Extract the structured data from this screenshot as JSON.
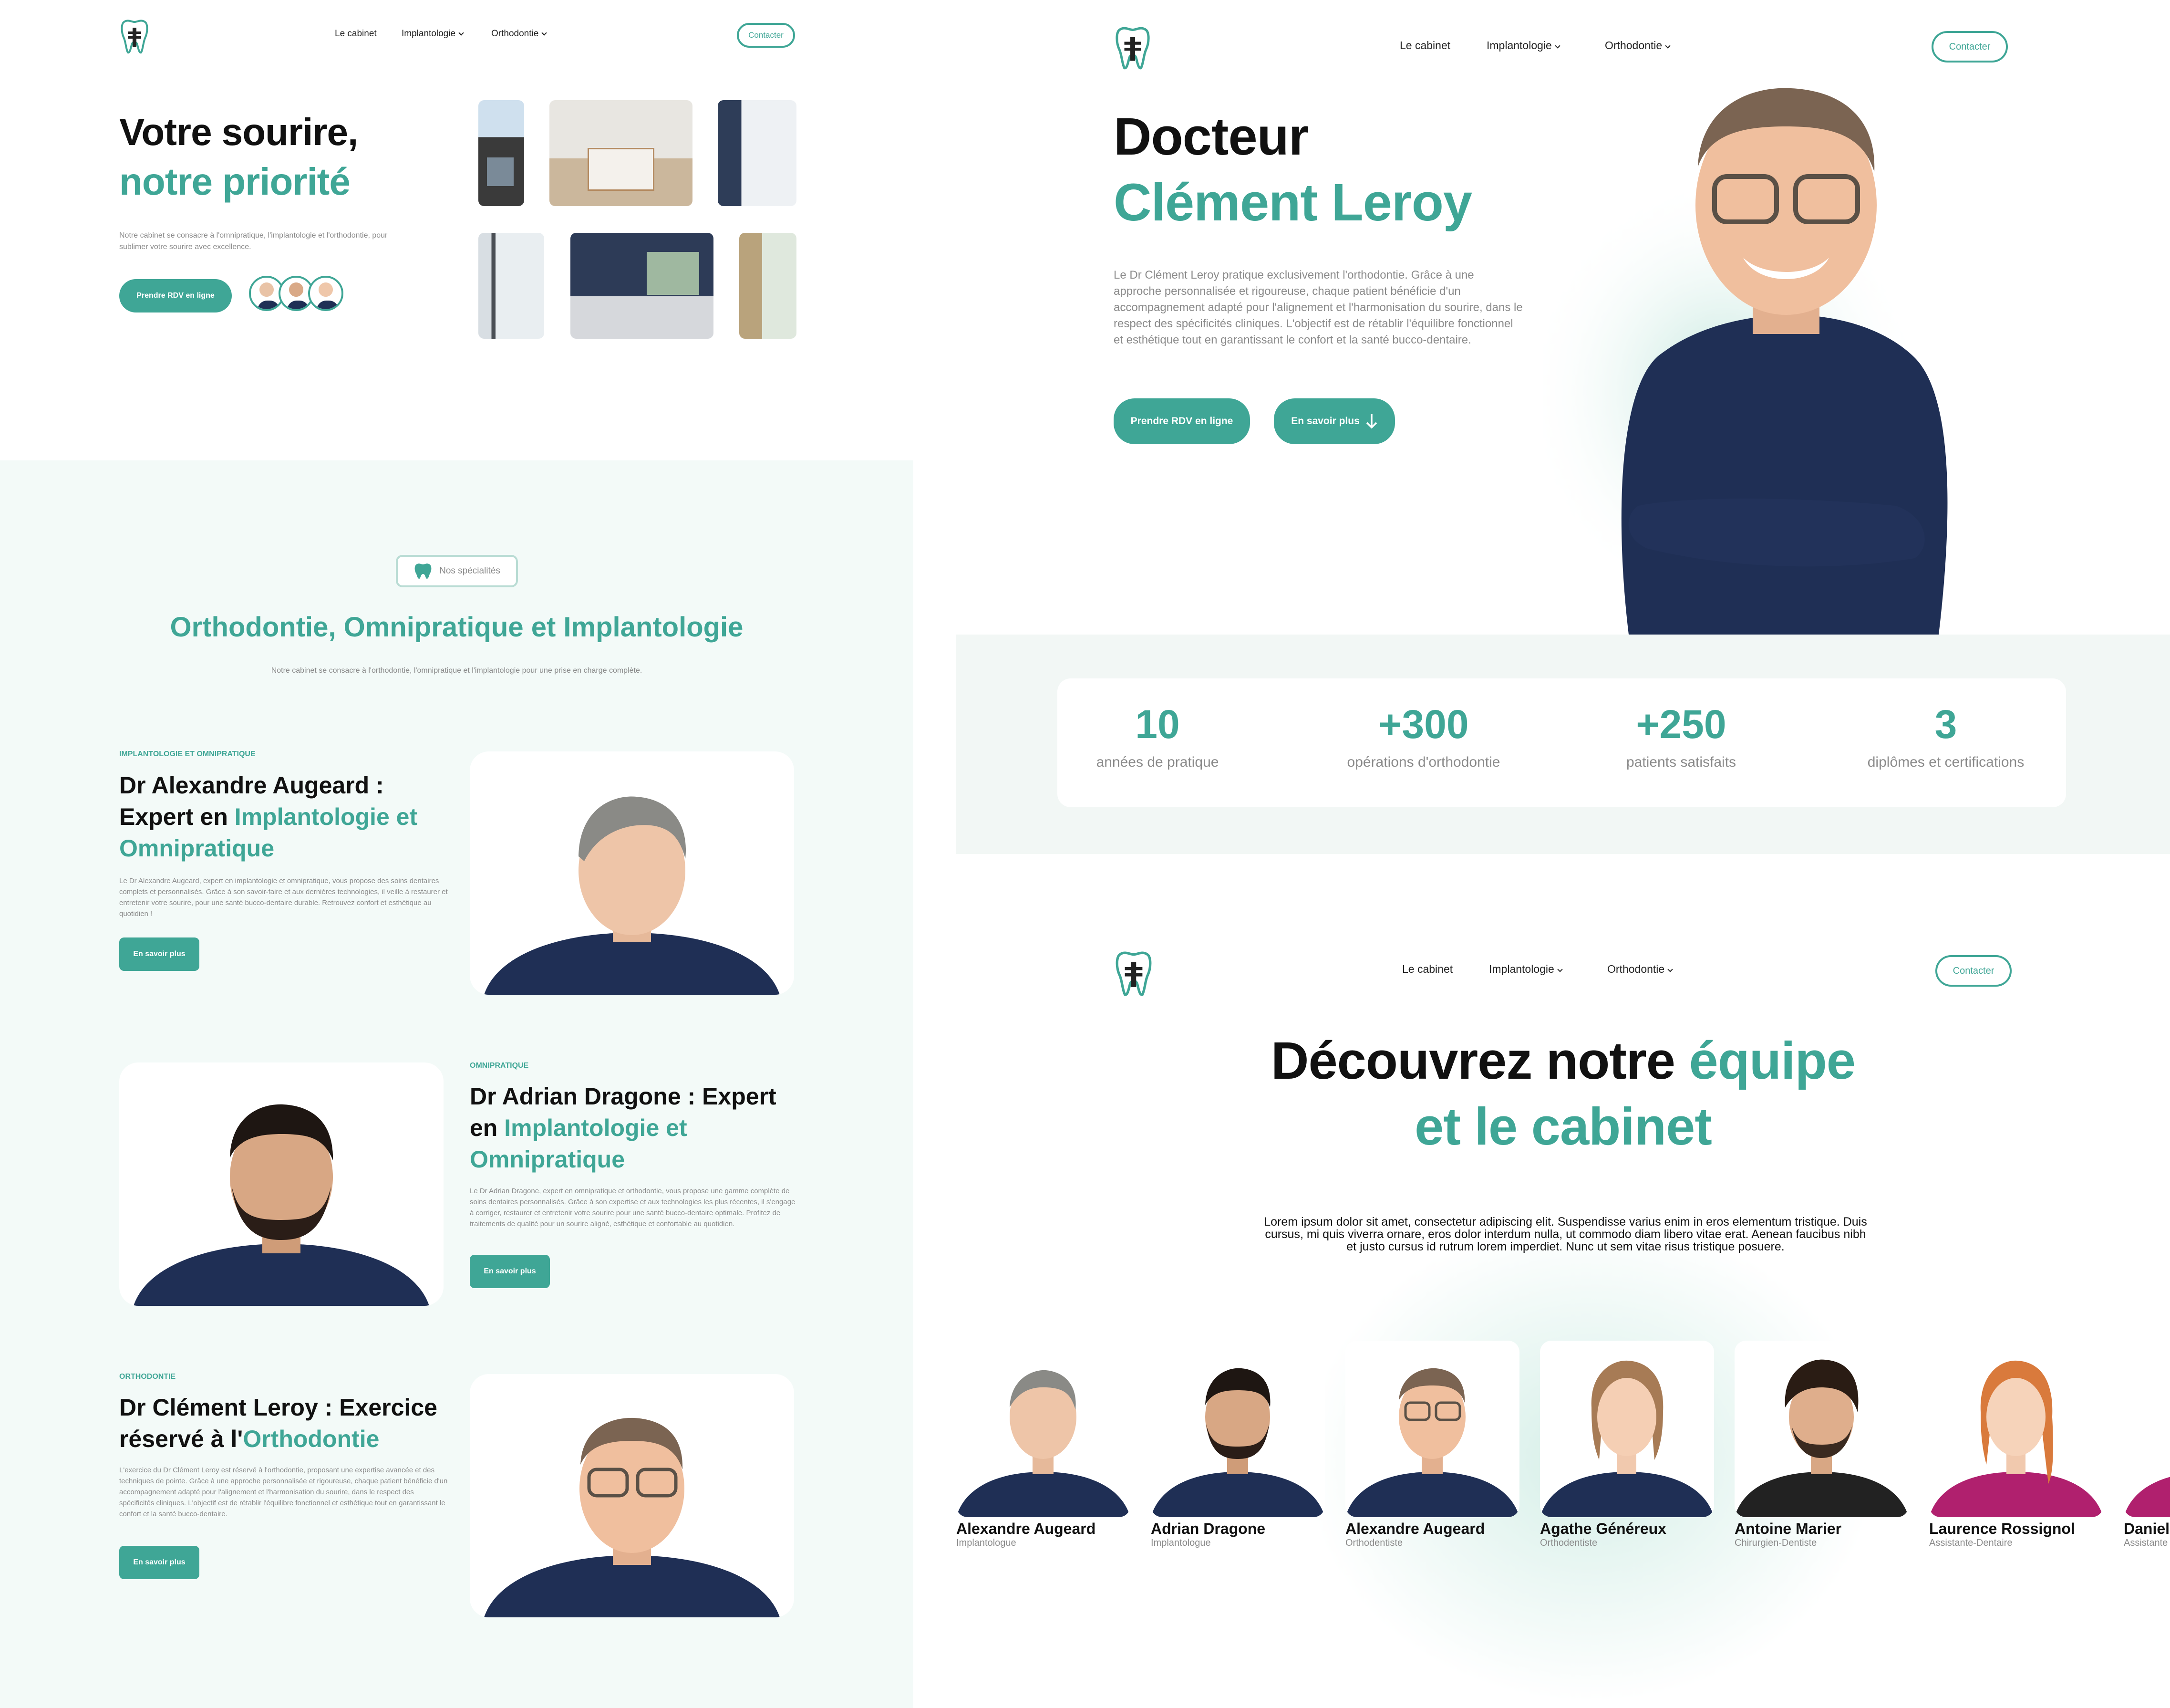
{
  "colors": {
    "accent": "#3fa696",
    "panel_mint": "#f3faf8",
    "stats_bg": "#f2f7f5",
    "navy_shirt": "#1f2f55",
    "magenta_shirt": "#b0206e"
  },
  "nav": {
    "links": {
      "cabinet": "Le cabinet",
      "implantologie": "Implantologie",
      "orthodontie": "Orthodontie"
    },
    "contact": "Contacter",
    "logo_icon": "tooth-implant-logo-icon"
  },
  "hero1": {
    "title_line1": "Votre sourire,",
    "title_line2": "notre priorité",
    "description": "Notre cabinet se consacre à l'omnipratique, l'implantologie et l'orthodontie, pour sublimer votre sourire avec excellence.",
    "cta": "Prendre RDV en ligne"
  },
  "specialties": {
    "badge": "Nos spécialités",
    "title": "Orthodontie, Omnipratique et Implantologie",
    "subtitle": "Notre cabinet se consacre à l'orthodontie, l'omnipratique et l'implantologie pour une prise en charge complète.",
    "doctors": [
      {
        "tag": "IMPLANTOLOGIE ET OMNIPRATIQUE",
        "title_plain_a": "Dr Alexandre Augeard : Expert en ",
        "title_accent": "Implantologie et Omnipratique",
        "title_plain_b": "",
        "text": "Le Dr Alexandre Augeard, expert en implantologie et omnipratique, vous propose des soins dentaires complets et personnalisés. Grâce à son savoir-faire et aux dernières technologies, il veille à restaurer et entretenir votre sourire, pour une santé bucco-dentaire durable. Retrouvez confort et esthétique au quotidien !",
        "button": "En savoir plus"
      },
      {
        "tag": "OMNIPRATIQUE",
        "title_plain_a": "Dr Adrian Dragone : Expert en ",
        "title_accent": "Implantologie et Omnipratique",
        "title_plain_b": "",
        "text": "Le Dr Adrian Dragone, expert en omnipratique et orthodontie, vous propose une gamme complète de soins dentaires personnalisés. Grâce à son expertise et aux technologies les plus récentes, il s'engage à corriger, restaurer et entretenir votre sourire pour une santé bucco-dentaire optimale. Profitez de traitements de qualité pour un sourire aligné, esthétique et confortable au quotidien.",
        "button": "En savoir plus"
      },
      {
        "tag": "ORTHODONTIE",
        "title_plain_a": "Dr Clément Leroy : Exercice réservé à l'",
        "title_accent": "Orthodontie",
        "title_plain_b": "",
        "text": "L'exercice du Dr Clément Leroy est réservé à l'orthodontie, proposant une expertise avancée et des techniques de pointe. Grâce à une approche personnalisée et rigoureuse, chaque patient bénéficie d'un accompagnement adapté pour l'alignement et l'harmonisation du sourire, dans le respect des spécificités cliniques. L'objectif est de rétablir l'équilibre fonctionnel et esthétique tout en garantissant le confort et la santé bucco-dentaire.",
        "button": "En savoir plus"
      }
    ]
  },
  "hero2": {
    "title_line1": "Docteur",
    "title_line2": "Clément Leroy",
    "description": "Le Dr Clément Leroy pratique exclusivement l'orthodontie. Grâce à une approche personnalisée et rigoureuse, chaque patient bénéficie d'un accompagnement adapté pour l'alignement et l'harmonisation du sourire, dans le respect des spécificités cliniques. L'objectif est de rétablir l'équilibre fonctionnel et esthétique tout en garantissant le confort et la santé bucco-dentaire.",
    "cta_primary": "Prendre RDV en ligne",
    "cta_secondary": "En savoir plus",
    "arrow_icon": "arrow-down-icon"
  },
  "stats": [
    {
      "value": "10",
      "label": "années de pratique"
    },
    {
      "value": "+300",
      "label": "opérations d'orthodontie"
    },
    {
      "value": "+250",
      "label": "patients satisfaits"
    },
    {
      "value": "3",
      "label": "diplômes et certifications"
    }
  ],
  "team": {
    "title_plain": "Découvrez notre ",
    "title_accent_1": "équipe",
    "title_accent_2": "et le cabinet",
    "description": "Lorem ipsum dolor sit amet, consectetur adipiscing elit. Suspendisse varius enim in eros elementum tristique. Duis cursus, mi quis viverra ornare, eros dolor interdum nulla, ut commodo diam libero vitae erat. Aenean faucibus nibh et justo cursus id rutrum lorem imperdiet. Nunc ut sem vitae risus tristique posuere.",
    "members": [
      {
        "name": "Alexandre Augeard",
        "role": "Implantologue"
      },
      {
        "name": "Adrian Dragone",
        "role": "Implantologue"
      },
      {
        "name": "Alexandre Augeard",
        "role": "Orthodentiste"
      },
      {
        "name": "Agathe Généreux",
        "role": "Orthodentiste"
      },
      {
        "name": "Antoine Marier",
        "role": "Chirurgien-Dentiste"
      },
      {
        "name": "Laurence Rossignol",
        "role": "Assistante-Dentaire"
      },
      {
        "name": "Daniel",
        "role": "Assistante"
      }
    ]
  }
}
